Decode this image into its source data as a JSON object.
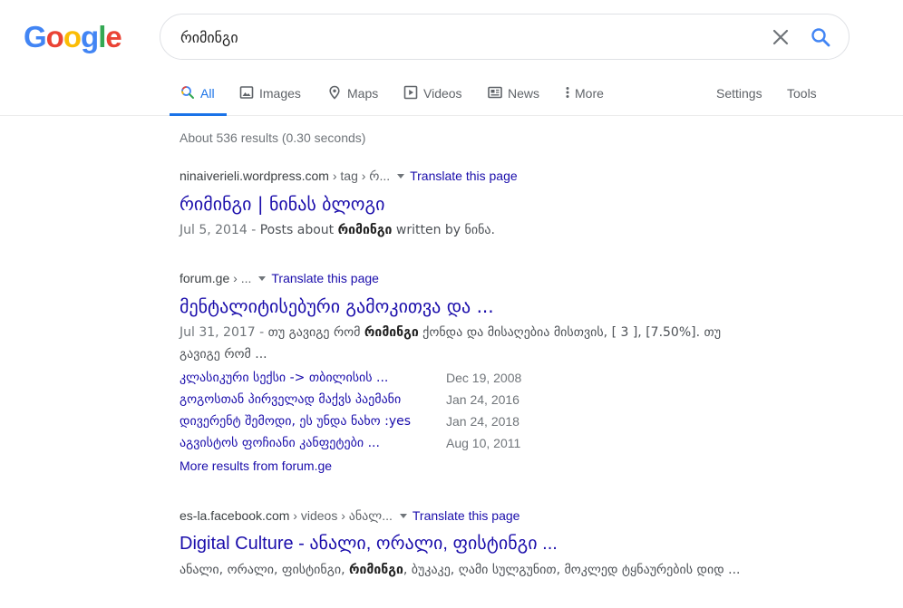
{
  "logo": "Google",
  "search": {
    "query": "რიმინგი",
    "placeholder": ""
  },
  "tabs": [
    {
      "label": "All",
      "icon": "search-icon",
      "active": true
    },
    {
      "label": "Images",
      "icon": "image-icon"
    },
    {
      "label": "Maps",
      "icon": "map-pin-icon"
    },
    {
      "label": "Videos",
      "icon": "video-icon"
    },
    {
      "label": "News",
      "icon": "news-icon"
    },
    {
      "label": "More",
      "icon": "more-vert-icon"
    }
  ],
  "tools": {
    "settings": "Settings",
    "tools": "Tools"
  },
  "stats": "About 536 results (0.30 seconds)",
  "results": [
    {
      "domain": "ninaiverieli.wordpress.com",
      "path": " › tag › რ...",
      "translate": "Translate this page",
      "title": "რიმინგი | ნინას ბლოგი",
      "date": "Jul 5, 2014 - ",
      "snippet_before": "Posts about ",
      "snippet_bold": "რიმინგი",
      "snippet_after": " written by ნინა."
    },
    {
      "domain": "forum.ge",
      "path": " › ...",
      "translate": "Translate this page",
      "title": "მენტალიტისებური გამოკითვა და ...",
      "date": "Jul 31, 2017 - ",
      "snippet_before": "თუ გავიგე რომ ",
      "snippet_bold": "რიმინგი",
      "snippet_after": " ქონდა და მისაღებია მისთვის, [ 3 ], [7.50%]. თუ გავიგე რომ ..."
    },
    {
      "domain": "es-la.facebook.com",
      "path": " › videos › ანალ...",
      "translate": "Translate this page",
      "title": "Digital Culture - ანალი, ორალი, ფისტინგი ...",
      "snippet_before": "ანალი, ორალი, ფისტინგი, ",
      "snippet_bold": "რიმინგი",
      "snippet_after": ", ბუკაკე, ღამი სულგუნით, მოკლედ ტყნაურების დიდ ..."
    }
  ],
  "sitelinks": [
    {
      "title": "კლასიკური სექსი -> თბილისის ...",
      "date": "Dec 19, 2008"
    },
    {
      "title": "გოგოსთან პირველად მაქვს პაემანი",
      "date": "Jan 24, 2016"
    },
    {
      "title": "დივერენტ შემოდი, ეს უნდა ნახო :yes",
      "date": "Jan 24, 2018"
    },
    {
      "title": "აგვისტოს ფოჩიანი კანფეტები ...",
      "date": "Aug 10, 2011"
    }
  ],
  "more_results": "More results from forum.ge",
  "colors": {
    "link": "#1a0dab",
    "active_tab": "#1a73e8",
    "google_blue": "#4285f4",
    "google_red": "#ea4335",
    "google_yellow": "#fbbc05",
    "google_green": "#34a853"
  }
}
